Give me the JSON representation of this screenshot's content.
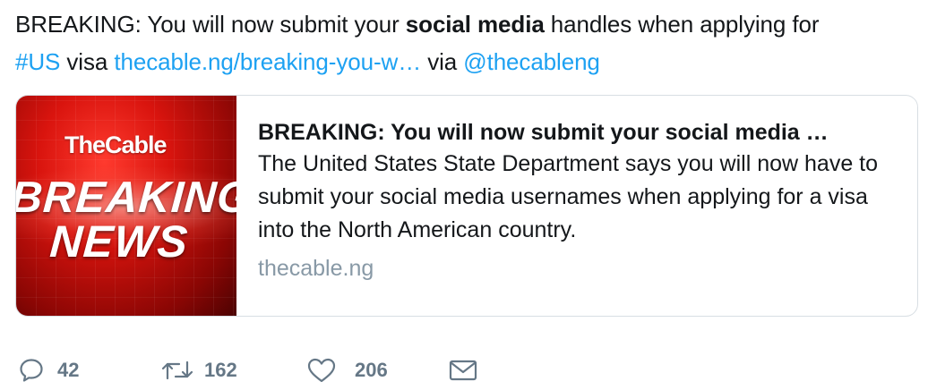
{
  "tweet": {
    "text_part1": "BREAKING: You will now submit your ",
    "text_bold": "social media",
    "text_part2": " handles when applying for",
    "hashtag": "#US",
    "text_part3": " visa ",
    "url": "thecable.ng/breaking-you-w…",
    "text_part4": " via ",
    "mention": "@thecableng"
  },
  "card": {
    "image": {
      "brand": "TheCable",
      "line1": "BREAKING",
      "line2": "NEWS",
      "color": "#d9140e"
    },
    "title": "BREAKING: You will now submit your social media …",
    "description": "The United States State Department says you will now have to submit your social media usernames when applying for a visa into the North American country.",
    "domain": "thecable.ng"
  },
  "actions": {
    "reply_count": "42",
    "retweet_count": "162",
    "like_count": "206",
    "icons": [
      "reply-icon",
      "retweet-icon",
      "like-icon",
      "message-icon"
    ]
  },
  "colors": {
    "link": "#1da1f2",
    "secondary": "#657786",
    "muted": "#8899a6"
  }
}
